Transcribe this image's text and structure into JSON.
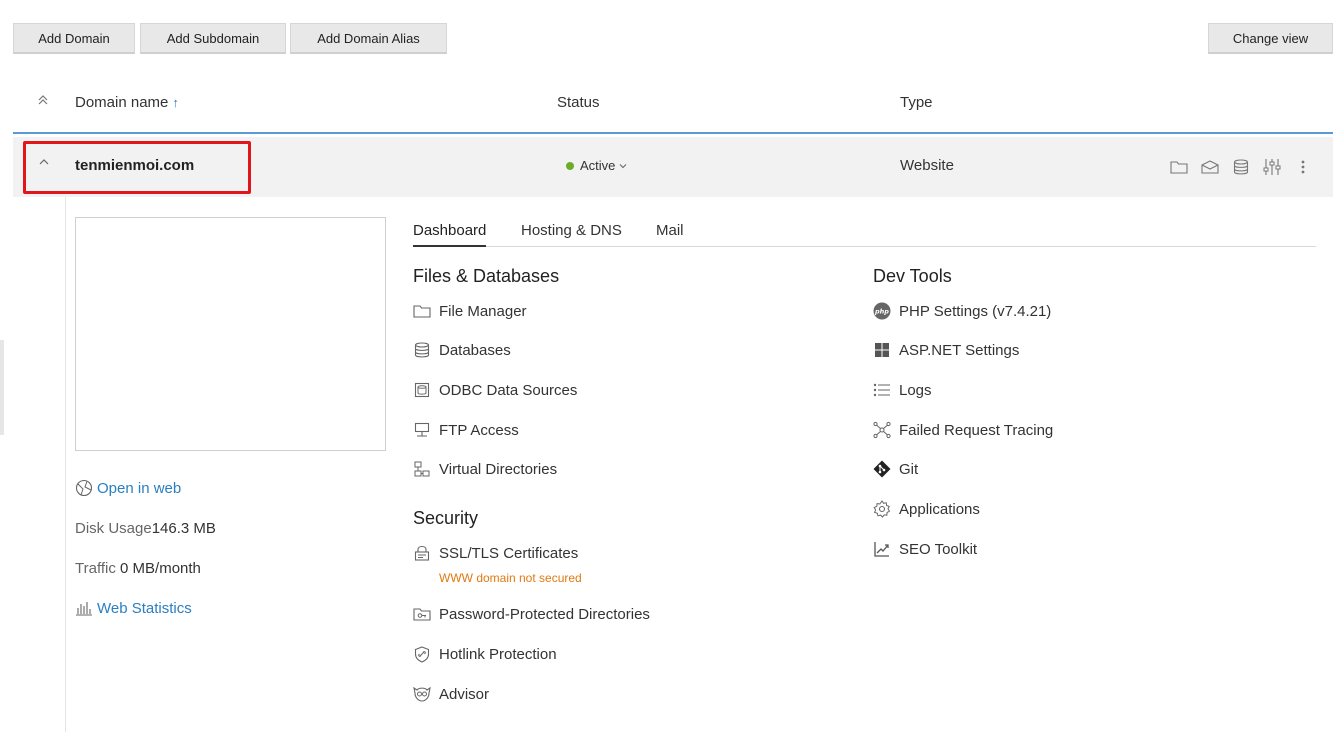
{
  "toolbar": {
    "add_domain": "Add Domain",
    "add_subdomain": "Add Subdomain",
    "add_domain_alias": "Add Domain Alias",
    "change_view": "Change view"
  },
  "table": {
    "col_name": "Domain name",
    "sort_arrow": "↑",
    "col_status": "Status",
    "col_type": "Type"
  },
  "domain": {
    "name": "tenmienmoi.com",
    "status": "Active",
    "status_color": "#6cad28",
    "type": "Website"
  },
  "left_panel": {
    "open_in_web": "Open in web",
    "disk_usage_label": "Disk Usage",
    "disk_usage_value": "146.3 MB",
    "traffic_label": "Traffic",
    "traffic_value": "0 MB/month",
    "web_statistics": "Web Statistics"
  },
  "tabs": [
    "Dashboard",
    "Hosting & DNS",
    "Mail"
  ],
  "files_db": {
    "title": "Files & Databases",
    "items": [
      {
        "label": "File Manager",
        "icon": "folder-icon"
      },
      {
        "label": "Databases",
        "icon": "database-icon"
      },
      {
        "label": "ODBC Data Sources",
        "icon": "odbc-icon"
      },
      {
        "label": "FTP Access",
        "icon": "ftp-icon"
      },
      {
        "label": "Virtual Directories",
        "icon": "virtual-directories-icon"
      }
    ]
  },
  "security": {
    "title": "Security",
    "items": [
      {
        "label": "SSL/TLS Certificates",
        "icon": "certificate-icon",
        "warning": "WWW domain not secured"
      },
      {
        "label": "Password-Protected Directories",
        "icon": "protected-dir-icon"
      },
      {
        "label": "Hotlink Protection",
        "icon": "hotlink-icon"
      },
      {
        "label": "Advisor",
        "icon": "advisor-icon"
      }
    ]
  },
  "dev_tools": {
    "title": "Dev Tools",
    "items": [
      {
        "label": "PHP Settings (v7.4.21)",
        "icon": "php-icon"
      },
      {
        "label": "ASP.NET Settings",
        "icon": "windows-icon"
      },
      {
        "label": "Logs",
        "icon": "logs-icon"
      },
      {
        "label": "Failed Request Tracing",
        "icon": "tracing-icon"
      },
      {
        "label": "Git",
        "icon": "git-icon"
      },
      {
        "label": "Applications",
        "icon": "gear-icon"
      },
      {
        "label": "SEO Toolkit",
        "icon": "seo-chart-icon"
      }
    ]
  },
  "colors": {
    "accent_link": "#2a7fc1",
    "highlight_box": "#e0161b",
    "warning": "#e07a10"
  }
}
